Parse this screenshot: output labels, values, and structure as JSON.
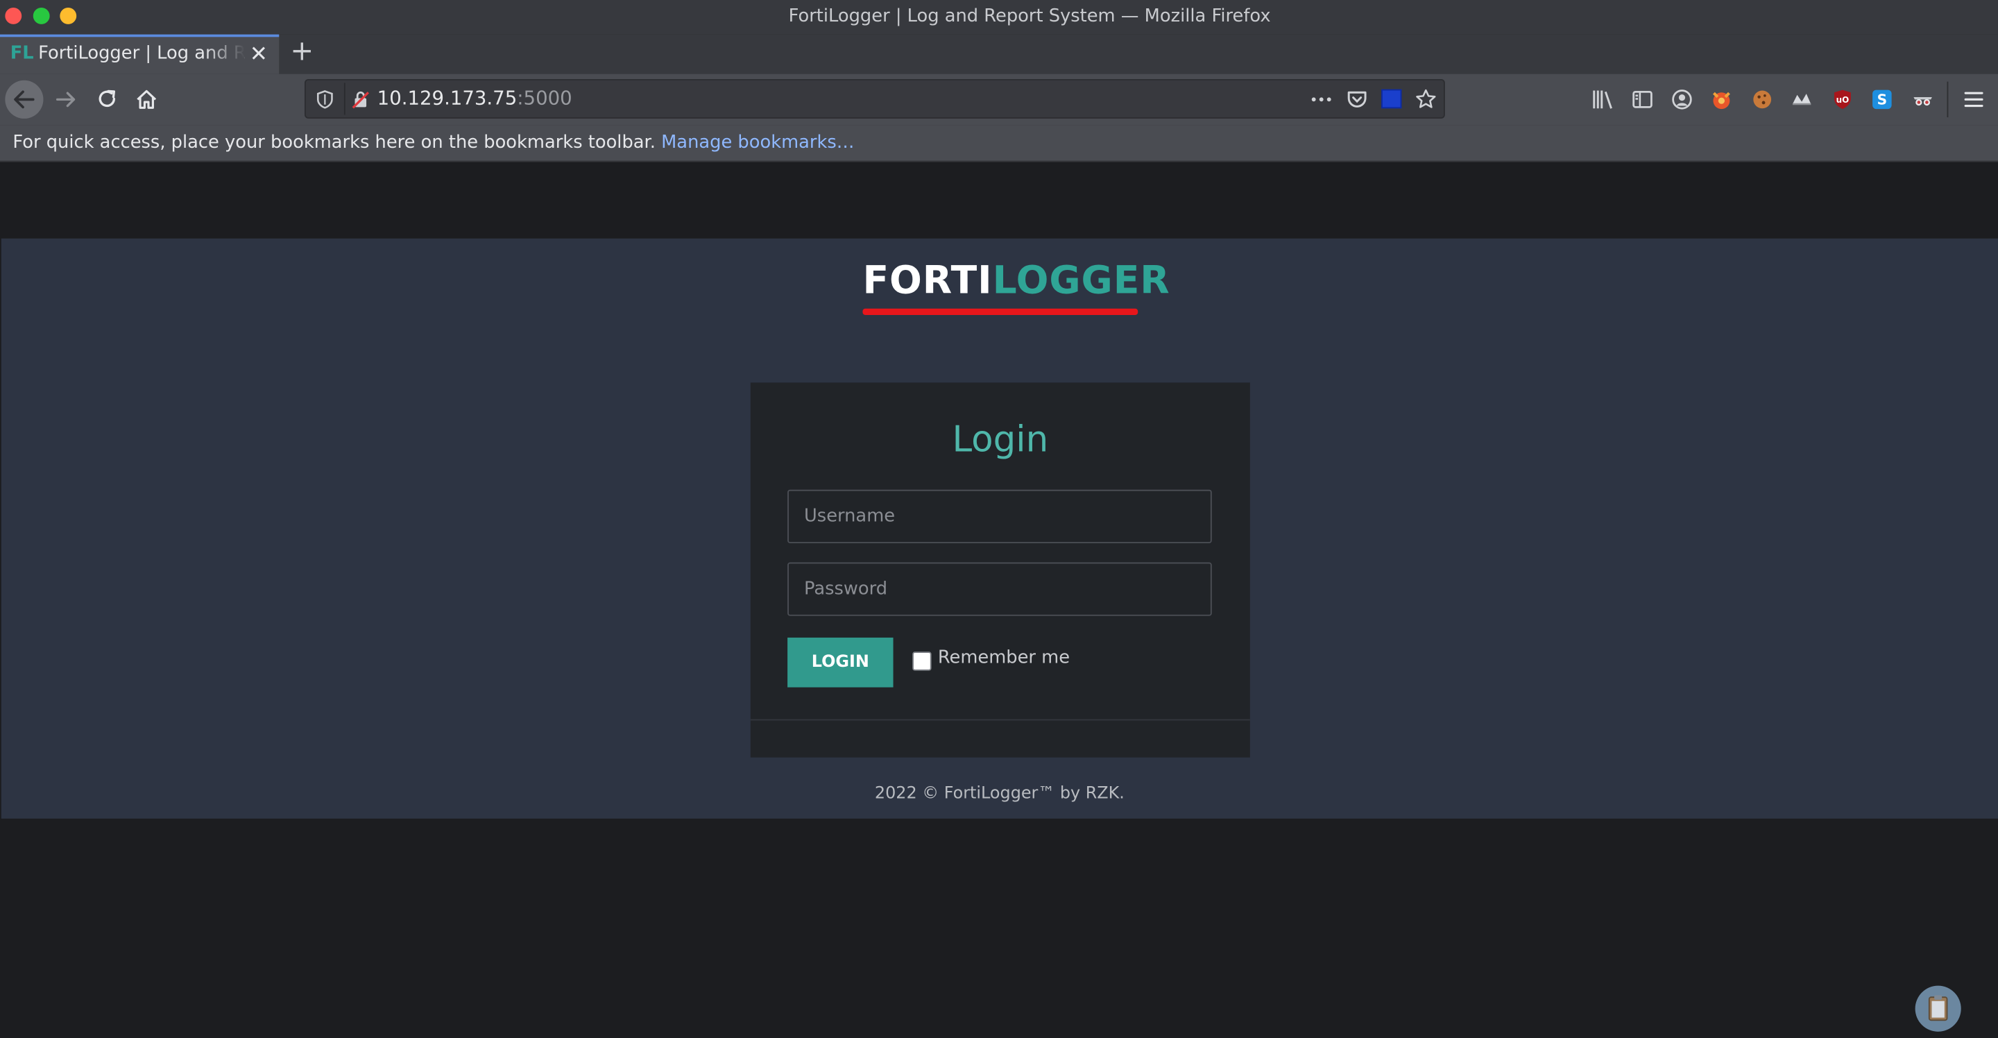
{
  "window": {
    "title": "FortiLogger | Log and Report System — Mozilla Firefox"
  },
  "tabs": [
    {
      "favicon_text": "FL",
      "label": "FortiLogger | Log and Report System"
    }
  ],
  "nav": {
    "url_host": "10.129.173.75",
    "url_port": ":5000"
  },
  "bookmarks_bar": {
    "message": "For quick access, place your bookmarks here on the bookmarks toolbar.",
    "link": "Manage bookmarks…"
  },
  "page": {
    "logo_part1": "FORTI",
    "logo_part2": "LOGGER",
    "login_title": "Login",
    "username_placeholder": "Username",
    "password_placeholder": "Password",
    "login_button": "LOGIN",
    "remember_label": "Remember me",
    "copyright": "2022 © FortiLogger™ by RZK."
  },
  "colors": {
    "accent_teal": "#2fa596",
    "logo_underline": "#e7161b",
    "page_background": "#2d3443",
    "card_background": "#212428"
  },
  "icons": [
    "back-arrow-icon",
    "forward-arrow-icon",
    "reload-icon",
    "home-icon",
    "shield-icon",
    "insecure-lock-icon",
    "more-actions-icon",
    "pocket-icon",
    "container-flag-icon",
    "bookmark-star-icon",
    "library-icon",
    "sidebar-icon",
    "account-icon",
    "extension-icons",
    "hamburger-menu-icon",
    "clipboard-icon"
  ]
}
